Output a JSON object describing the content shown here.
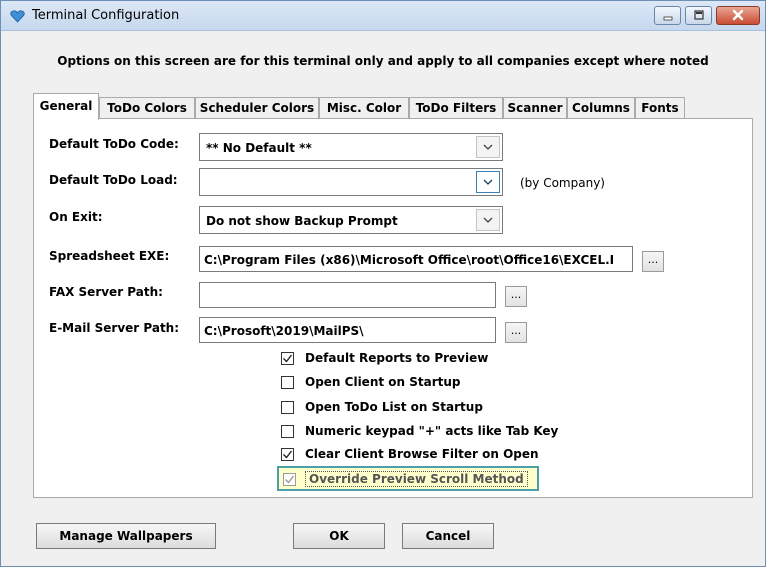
{
  "window": {
    "title": "Terminal Configuration"
  },
  "info": "Options on this screen are for this terminal only and apply to all companies except where noted",
  "tabs": [
    {
      "label": "General",
      "active": true
    },
    {
      "label": "ToDo Colors"
    },
    {
      "label": "Scheduler Colors"
    },
    {
      "label": "Misc. Color"
    },
    {
      "label": "ToDo Filters"
    },
    {
      "label": "Scanner"
    },
    {
      "label": "Columns"
    },
    {
      "label": "Fonts"
    }
  ],
  "form": {
    "default_todo_code": {
      "label": "Default ToDo Code:",
      "value": "** No Default **"
    },
    "default_todo_load": {
      "label": "Default ToDo Load:",
      "value": "",
      "note": "(by Company)"
    },
    "on_exit": {
      "label": "On Exit:",
      "value": "Do not show Backup Prompt"
    },
    "spreadsheet_exe": {
      "label": "Spreadsheet EXE:",
      "value": "C:\\Program Files (x86)\\Microsoft Office\\root\\Office16\\EXCEL.I"
    },
    "fax_server_path": {
      "label": "FAX Server Path:",
      "value": ""
    },
    "email_server_path": {
      "label": "E-Mail Server Path:",
      "value": "C:\\Prosoft\\2019\\MailPS\\"
    },
    "browse_label": "..."
  },
  "checkboxes": [
    {
      "label": "Default Reports to Preview",
      "checked": true
    },
    {
      "label": "Open Client on Startup",
      "checked": false
    },
    {
      "label": "Open ToDo List on Startup",
      "checked": false
    },
    {
      "label": "Numeric keypad \"+\" acts like Tab Key",
      "checked": false
    },
    {
      "label": "Clear Client Browse Filter on Open",
      "checked": true
    },
    {
      "label": "Override Preview Scroll Method",
      "checked": true
    }
  ],
  "buttons": {
    "manage_wallpapers": "Manage Wallpapers",
    "ok": "OK",
    "cancel": "Cancel"
  },
  "colors": {
    "highlight_fill": "#ffffcc",
    "highlight_border": "#4aa0a8",
    "titlebar": "#c6d8ee"
  }
}
